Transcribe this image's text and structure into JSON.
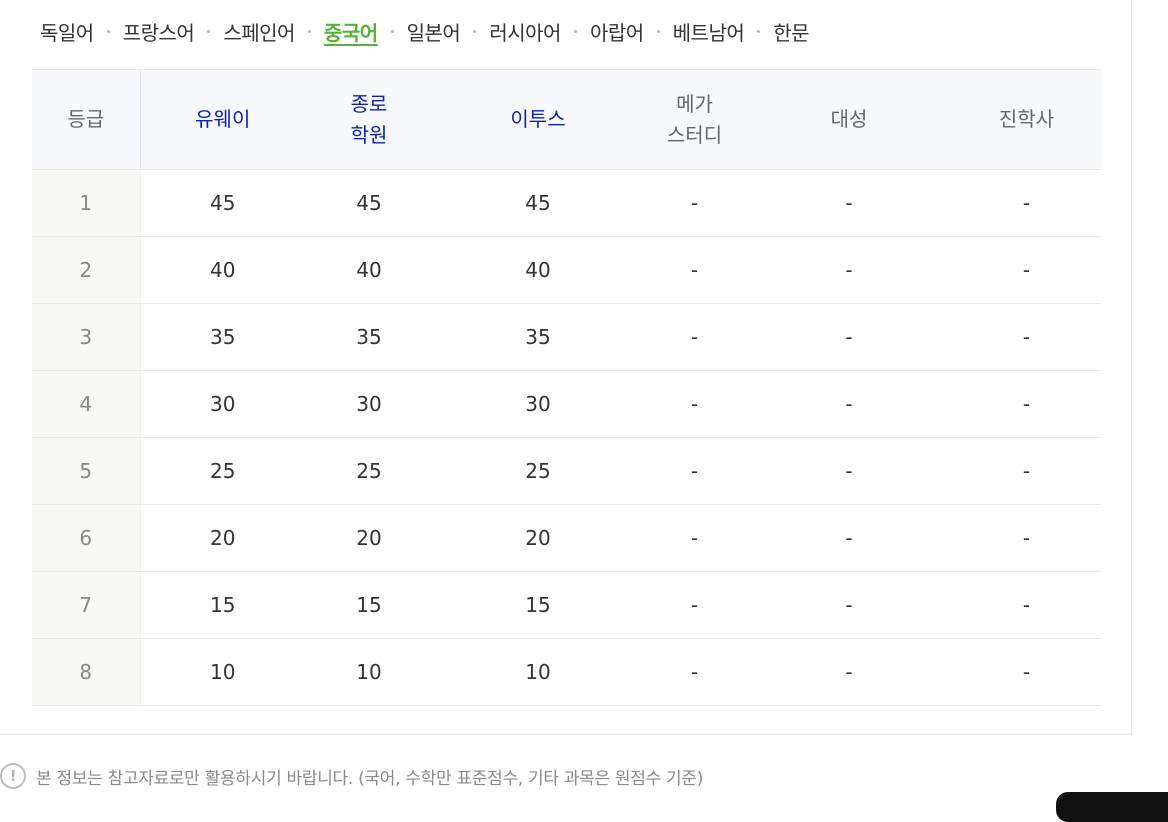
{
  "tabs": [
    {
      "label": "독일어",
      "active": false
    },
    {
      "label": "프랑스어",
      "active": false
    },
    {
      "label": "스페인어",
      "active": false
    },
    {
      "label": "중국어",
      "active": true
    },
    {
      "label": "일본어",
      "active": false
    },
    {
      "label": "러시아어",
      "active": false
    },
    {
      "label": "아랍어",
      "active": false
    },
    {
      "label": "베트남어",
      "active": false
    },
    {
      "label": "한문",
      "active": false
    }
  ],
  "table": {
    "headers": [
      {
        "line1": "등급",
        "line2": ""
      },
      {
        "line1": "유웨이",
        "line2": ""
      },
      {
        "line1": "종로",
        "line2": "학원"
      },
      {
        "line1": "이투스",
        "line2": ""
      },
      {
        "line1": "메가",
        "line2": "스터디"
      },
      {
        "line1": "대성",
        "line2": ""
      },
      {
        "line1": "진학사",
        "line2": ""
      }
    ],
    "rows": [
      {
        "grade": "1",
        "values": [
          "45",
          "45",
          "45",
          "-",
          "-",
          "-"
        ]
      },
      {
        "grade": "2",
        "values": [
          "40",
          "40",
          "40",
          "-",
          "-",
          "-"
        ]
      },
      {
        "grade": "3",
        "values": [
          "35",
          "35",
          "35",
          "-",
          "-",
          "-"
        ]
      },
      {
        "grade": "4",
        "values": [
          "30",
          "30",
          "30",
          "-",
          "-",
          "-"
        ]
      },
      {
        "grade": "5",
        "values": [
          "25",
          "25",
          "25",
          "-",
          "-",
          "-"
        ]
      },
      {
        "grade": "6",
        "values": [
          "20",
          "20",
          "20",
          "-",
          "-",
          "-"
        ]
      },
      {
        "grade": "7",
        "values": [
          "15",
          "15",
          "15",
          "-",
          "-",
          "-"
        ]
      },
      {
        "grade": "8",
        "values": [
          "10",
          "10",
          "10",
          "-",
          "-",
          "-"
        ]
      }
    ]
  },
  "note": {
    "icon": "exclamation-circle-icon",
    "icon_glyph": "!",
    "text": "본 정보는 참고자료로만 활용하시기 바랍니다. (국어, 수학만 표준점수, 기타 과목은 원점수 기준)"
  },
  "colors": {
    "active_tab": "#54b435",
    "link_header": "#1122aa",
    "header_bg": "#f6f8fb",
    "grade_bg": "#f8f9f5"
  }
}
